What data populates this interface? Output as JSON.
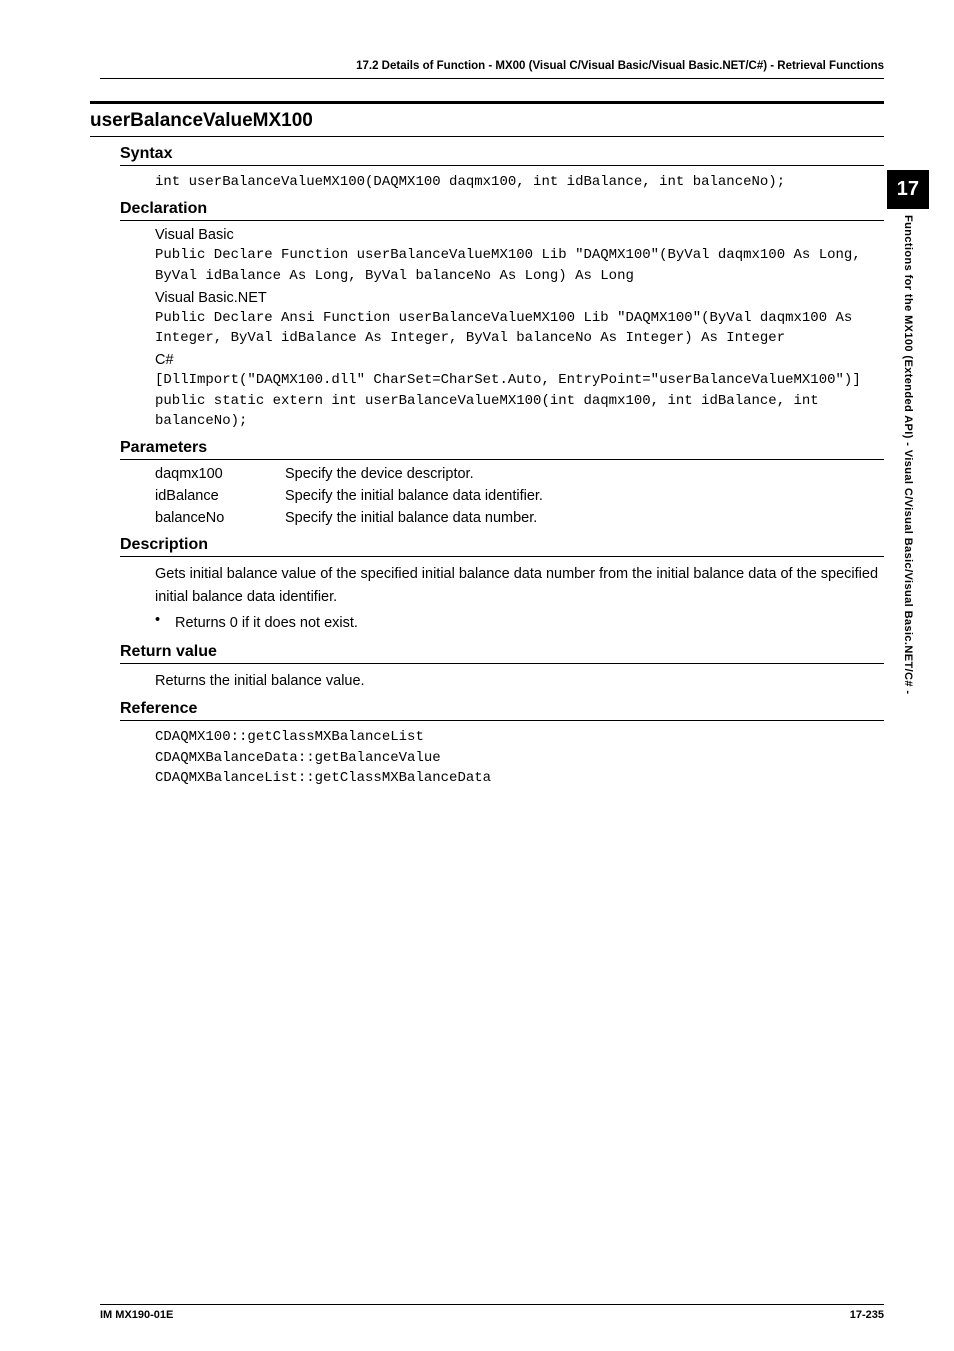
{
  "header": {
    "running": "17.2  Details of  Function - MX00 (Visual C/Visual Basic/Visual Basic.NET/C#) - Retrieval Functions"
  },
  "fn": {
    "name": "userBalanceValueMX100"
  },
  "syntax": {
    "heading": "Syntax",
    "code": "int userBalanceValueMX100(DAQMX100 daqmx100, int idBalance, int balanceNo);"
  },
  "declaration": {
    "heading": "Declaration",
    "vb_label": "Visual Basic",
    "vb_code": "Public Declare Function userBalanceValueMX100 Lib \"DAQMX100\"(ByVal daqmx100 As Long, ByVal idBalance As Long, ByVal balanceNo As Long) As Long",
    "vbnet_label": "Visual Basic.NET",
    "vbnet_code": "Public Declare Ansi Function userBalanceValueMX100 Lib \"DAQMX100\"(ByVal daqmx100 As Integer, ByVal idBalance As Integer, ByVal balanceNo As Integer) As Integer",
    "cs_label": "C#",
    "cs_code": "[DllImport(\"DAQMX100.dll\" CharSet=CharSet.Auto, EntryPoint=\"userBalanceValueMX100\")]\npublic static extern int userBalanceValueMX100(int daqmx100, int idBalance, int balanceNo);"
  },
  "parameters": {
    "heading": "Parameters",
    "rows": [
      {
        "name": "daqmx100",
        "desc": "Specify the device descriptor."
      },
      {
        "name": "idBalance",
        "desc": "Specify the initial balance data identifier."
      },
      {
        "name": "balanceNo",
        "desc": "Specify the initial balance data number."
      }
    ]
  },
  "description": {
    "heading": "Description",
    "text": "Gets initial balance value of the specified initial balance data number from the initial balance data of the specified initial balance data identifier.",
    "bullet": "Returns 0 if it does not exist."
  },
  "returnvalue": {
    "heading": "Return value",
    "text": "Returns the initial balance value."
  },
  "reference": {
    "heading": "Reference",
    "code": "CDAQMX100::getClassMXBalanceList\nCDAQMXBalanceData::getBalanceValue\nCDAQMXBalanceList::getClassMXBalanceData"
  },
  "sidetab": {
    "chapter": "17",
    "text": "Functions for the MX100 (Extended API) - Visual C/Visual Basic/Visual Basic.NET/C# -"
  },
  "footer": {
    "left": "IM MX190-01E",
    "right": "17-235"
  }
}
